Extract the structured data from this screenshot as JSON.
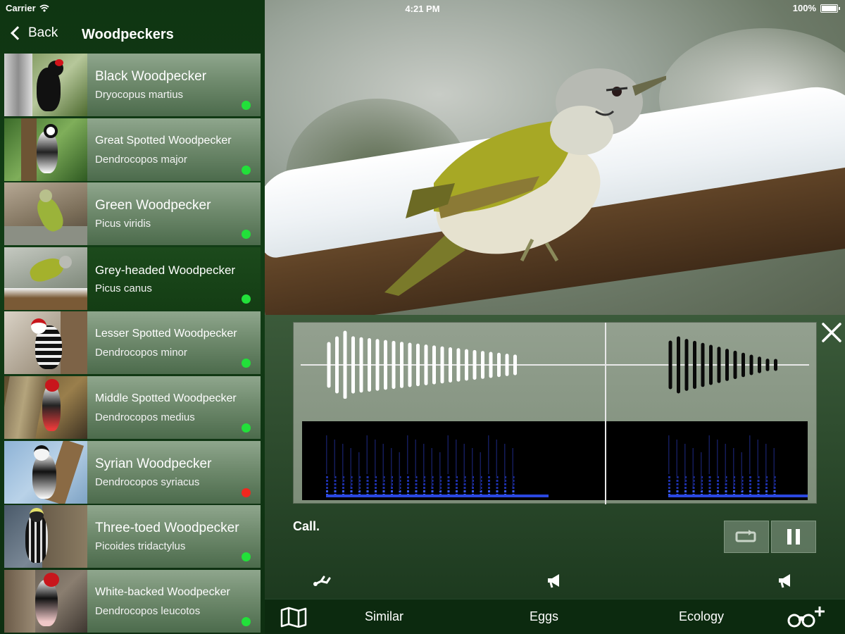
{
  "status_bar": {
    "carrier": "Carrier",
    "time": "4:21 PM",
    "battery": "100%"
  },
  "nav": {
    "back_label": "Back",
    "title": "Woodpeckers"
  },
  "species": [
    {
      "name": "Black Woodpecker",
      "latin": "Dryocopus martius",
      "status": "green"
    },
    {
      "name": "Great Spotted Woodpecker",
      "latin": "Dendrocopos major",
      "status": "green"
    },
    {
      "name": "Green Woodpecker",
      "latin": "Picus viridis",
      "status": "green"
    },
    {
      "name": "Grey-headed Woodpecker",
      "latin": "Picus canus",
      "status": "green",
      "selected": true
    },
    {
      "name": "Lesser Spotted Woodpecker",
      "latin": "Dendrocopos minor",
      "status": "green"
    },
    {
      "name": "Middle Spotted Woodpecker",
      "latin": "Dendrocopos medius",
      "status": "green"
    },
    {
      "name": "Syrian Woodpecker",
      "latin": "Dendrocopos syriacus",
      "status": "red"
    },
    {
      "name": "Three-toed Woodpecker",
      "latin": "Picoides tridactylus",
      "status": "green"
    },
    {
      "name": "White-backed Woodpecker",
      "latin": "Dendrocopos leucotos",
      "status": "green"
    }
  ],
  "status_colors": {
    "green": "#22e03a",
    "red": "#f0281e"
  },
  "sound": {
    "label": "Call."
  },
  "tabs": {
    "similar": "Similar",
    "eggs": "Eggs",
    "ecology": "Ecology"
  }
}
